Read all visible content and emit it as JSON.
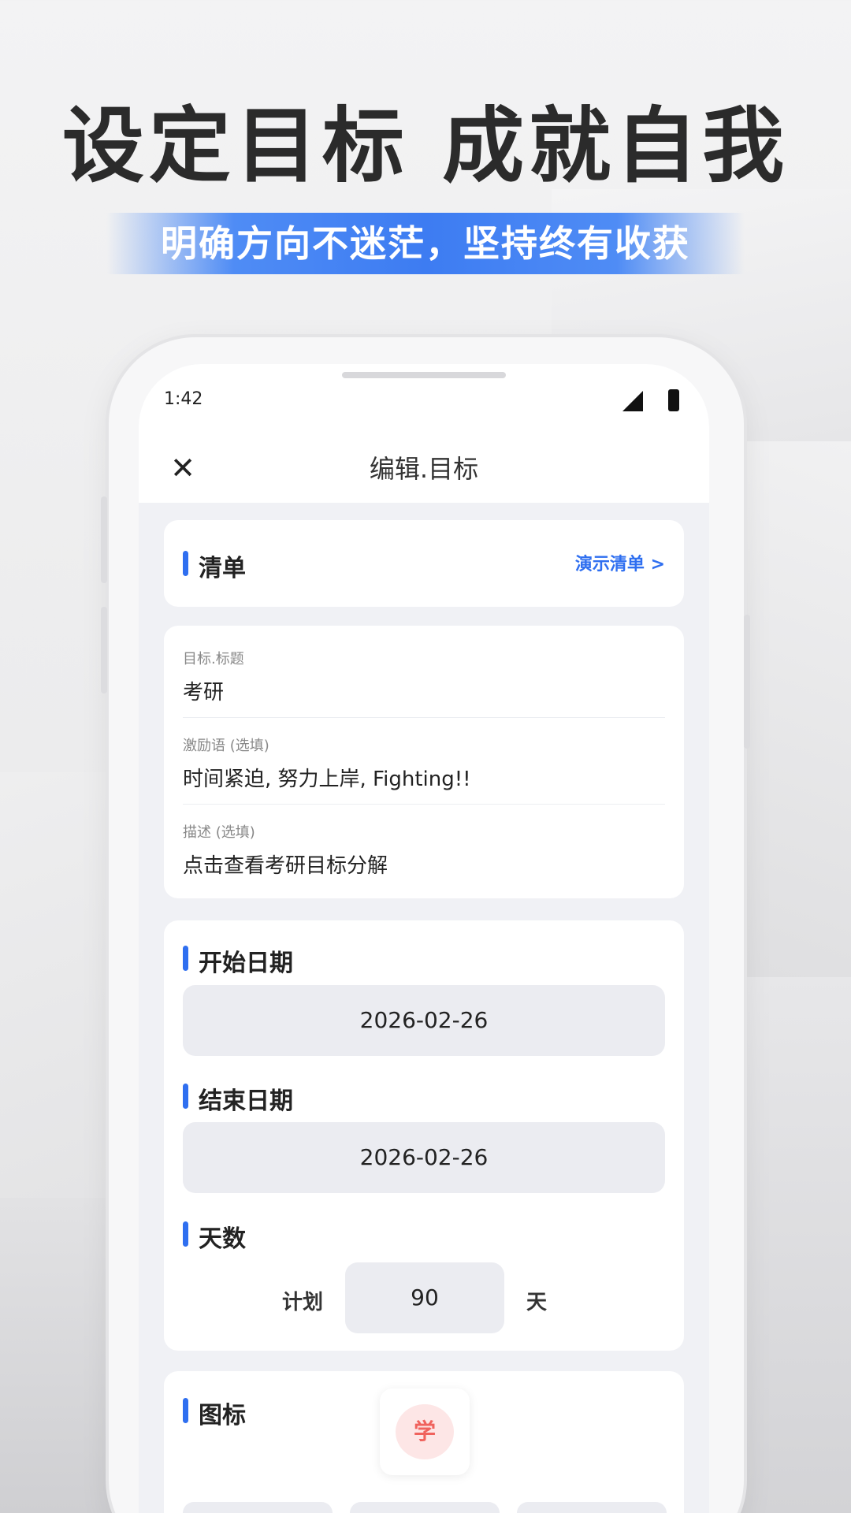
{
  "promo": {
    "headline": "设定目标 成就自我",
    "subline": "明确方向不迷茫，坚持终有收获"
  },
  "status_bar": {
    "time": "1:42"
  },
  "navbar": {
    "title": "编辑.目标"
  },
  "list_card": {
    "title": "清单",
    "link_label": "演示清单 >"
  },
  "fields": [
    {
      "label": "目标.标题",
      "value": "考研"
    },
    {
      "label": "激励语 (选填)",
      "value": "时间紧迫, 努力上岸, Fighting!!"
    },
    {
      "label": "描述 (选填)",
      "value": "点击查看考研目标分解"
    }
  ],
  "dates": {
    "start_title": "开始日期",
    "start_value": "2026-02-26",
    "end_title": "结束日期",
    "end_value": "2026-02-26",
    "days_title": "天数",
    "plan_label": "计划",
    "days_value": "90",
    "unit": "天"
  },
  "icon_card": {
    "title": "图标",
    "icon_char": "学"
  },
  "colors": {
    "accent": "#2f6ff0",
    "icon_bg": "#fde6e6",
    "icon_fg": "#f0625d"
  }
}
